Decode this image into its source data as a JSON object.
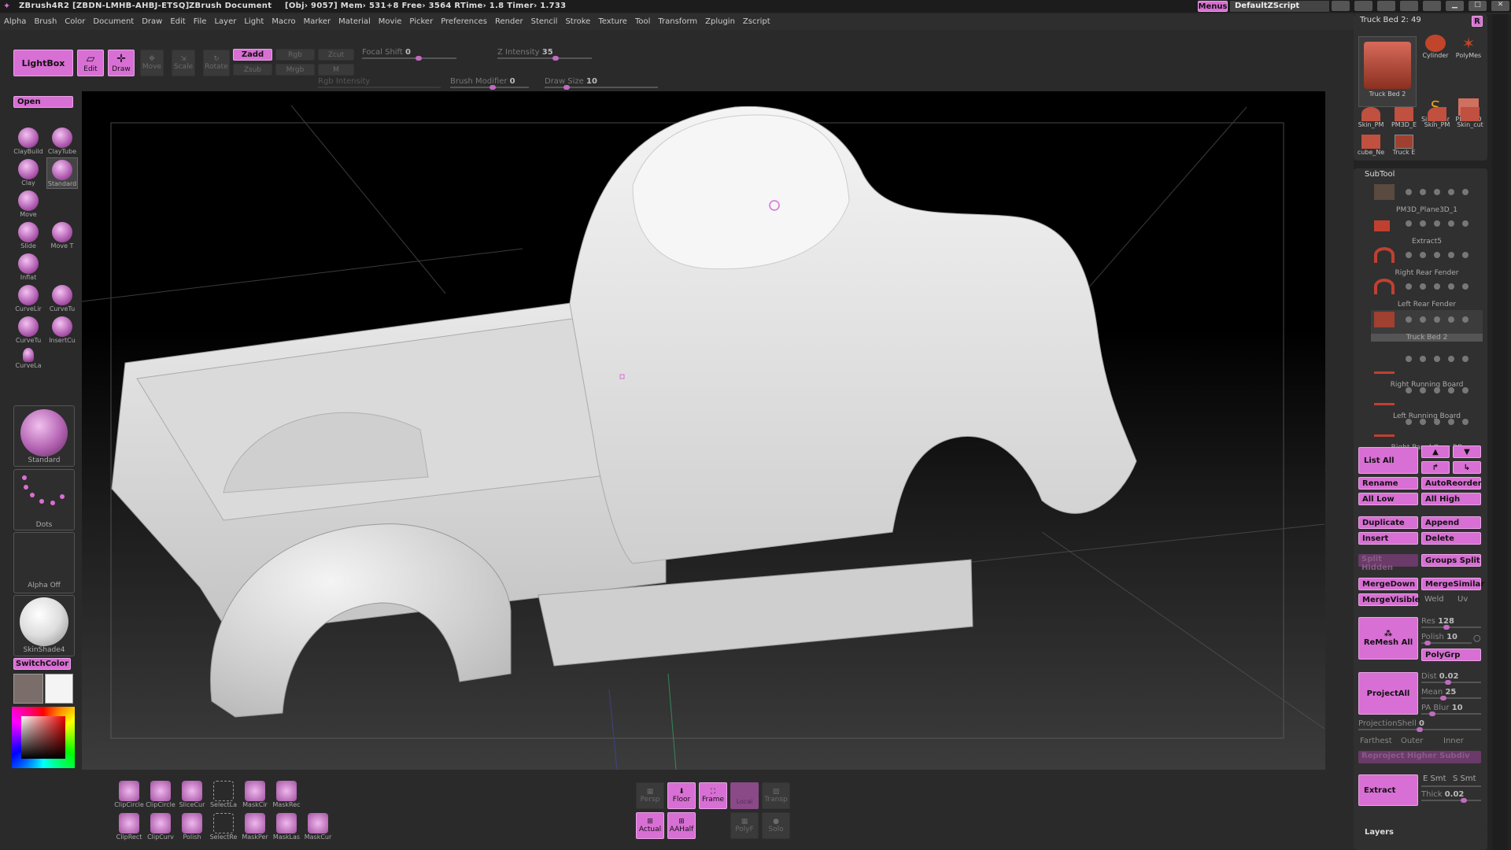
{
  "titlebar": {
    "app": "ZBrush4R2",
    "session": "[ZBDN-LMHB-AHBJ-ETSQ]",
    "document": "ZBrush Document",
    "stats": "[Obj› 9057] Mem› 531+8 Free› 3564 RTime› 1.8 Timer› 1.733",
    "menus_btn": "Menus",
    "script_btn": "DefaultZScript"
  },
  "menubar": [
    "Alpha",
    "Brush",
    "Color",
    "Document",
    "Draw",
    "Edit",
    "File",
    "Layer",
    "Light",
    "Macro",
    "Marker",
    "Material",
    "Movie",
    "Picker",
    "Preferences",
    "Render",
    "Stencil",
    "Stroke",
    "Texture",
    "Tool",
    "Transform",
    "Zplugin",
    "Zscript"
  ],
  "toolbar": {
    "lightbox": "LightBox",
    "edit": "Edit",
    "draw": "Draw",
    "move": "Move",
    "scale": "Scale",
    "rotate": "Rotate",
    "zadd": "Zadd",
    "zsub": "Zsub",
    "rgb": "Rgb",
    "mrgb": "Mrgb",
    "zcut": "Zcut",
    "m": "M",
    "focal_shift_label": "Focal Shift",
    "focal_shift_value": "0",
    "z_intensity_label": "Z Intensity",
    "z_intensity_value": "35",
    "rgb_intensity_label": "Rgb Intensity",
    "brush_modifier_label": "Brush Modifier",
    "brush_modifier_value": "0",
    "draw_size_label": "Draw Size",
    "draw_size_value": "10"
  },
  "left_tools": {
    "open": "Open",
    "brushes": [
      "ClayBuild",
      "ClayTube",
      "Clay",
      "Standard",
      "Move",
      "Slide",
      "Move T",
      "Inflat",
      "CurveLir",
      "CurveTu",
      "CurveTu",
      "InsertCu",
      "CurveLa"
    ],
    "brush_tile": "Standard",
    "stroke_tile": "Dots",
    "alpha_tile": "Alpha  Off",
    "material_tile": "SkinShade4",
    "switch_color": "SwitchColor"
  },
  "bottom_tools": {
    "row1": [
      "ClipCircle",
      "ClipCircle",
      "SliceCur",
      "SelectLa",
      "MaskCir",
      "MaskRec"
    ],
    "row2": [
      "ClipRect",
      "ClipCurv",
      "Polish",
      "SelectRe",
      "MaskPer",
      "MaskLas",
      "MaskCur"
    ],
    "center": [
      "Persp",
      "Floor",
      "Frame",
      "Local",
      "Transp",
      "Actual",
      "AAHalf",
      "PolyF",
      "Solo"
    ]
  },
  "tool_palette": {
    "current_tool": "Truck Bed 2: 49",
    "r_btn": "R",
    "thumbs": [
      "Truck Bed 2",
      "Cylinder",
      "PolyMes",
      "SimpleBr",
      "Plane3D",
      "Skin_PM",
      "PM3D_E",
      "Skin_PM",
      "Skin_cut",
      "cube_Ne",
      "Truck E"
    ]
  },
  "subtool": {
    "title": "SubTool",
    "items": [
      "PM3D_Plane3D_1",
      "Extract5",
      "Right Rear Fender",
      "Left Rear Fender",
      "Truck Bed 2",
      "Right Running Board",
      "Left Running Board",
      "Right Panel Over RB"
    ],
    "list_all": "List All",
    "rename": "Rename",
    "auto_reorder": "AutoReorder",
    "all_low": "All Low",
    "all_high": "All High",
    "duplicate": "Duplicate",
    "append": "Append",
    "insert": "Insert",
    "delete": "Delete",
    "split_hidden": "Split Hidden",
    "groups_split": "Groups Split",
    "merge_down": "MergeDown",
    "merge_similar": "MergeSimilar",
    "merge_visible": "MergeVisible",
    "weld": "Weld",
    "uv": "Uv",
    "remesh_all": "ReMesh All",
    "res_label": "Res",
    "res_value": "128",
    "polish_label": "Polish",
    "polish_value": "10",
    "polygrp": "PolyGrp",
    "project_all": "ProjectAll",
    "dist_label": "Dist",
    "dist_value": "0.02",
    "mean_label": "Mean",
    "mean_value": "25",
    "pa_blur_label": "PA Blur",
    "pa_blur_value": "10",
    "projection_shell_label": "ProjectionShell",
    "projection_shell_value": "0",
    "farthest": "Farthest",
    "outer": "Outer",
    "inner": "Inner",
    "reproject": "Reproject Higher Subdiv",
    "extract": "Extract",
    "e_smt": "E Smt",
    "s_smt": "S Smt",
    "thick_label": "Thick",
    "thick_value": "0.02",
    "layers": "Layers"
  },
  "colors": {
    "accent": "#d86fd4",
    "panel": "#2e2e2e",
    "model": "#e6e6e6"
  }
}
